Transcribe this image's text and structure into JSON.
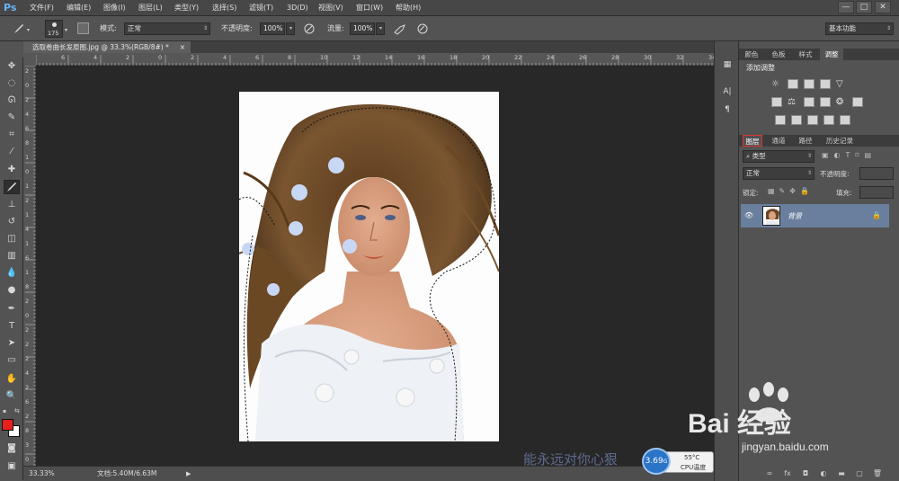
{
  "app": {
    "logo": "Ps"
  },
  "menu": [
    "文件(F)",
    "编辑(E)",
    "图像(I)",
    "图层(L)",
    "类型(Y)",
    "选择(S)",
    "滤镜(T)",
    "3D(D)",
    "视图(V)",
    "窗口(W)",
    "帮助(H)"
  ],
  "window_controls": [
    "—",
    "□",
    "✕"
  ],
  "options": {
    "brush_size": "175",
    "mode_label": "模式:",
    "mode_value": "正常",
    "opacity_label": "不透明度:",
    "opacity_value": "100%",
    "flow_label": "流量:",
    "flow_value": "100%",
    "workspace": "基本功能"
  },
  "document": {
    "tab_title": "选取卷曲长发原图.jpg @ 33.3%(RGB/8#) *",
    "close": "×"
  },
  "ruler_h": [
    "6",
    "4",
    "2",
    "0",
    "2",
    "4",
    "6",
    "8",
    "10",
    "12",
    "14",
    "16",
    "18",
    "20",
    "22",
    "24",
    "26",
    "28",
    "30",
    "32",
    "34"
  ],
  "ruler_v": [
    "2",
    "0",
    "2",
    "4",
    "6",
    "8",
    "1",
    "0",
    "1",
    "2",
    "1",
    "4",
    "1",
    "6",
    "1",
    "8",
    "2",
    "0",
    "2",
    "2",
    "2",
    "4",
    "2",
    "6",
    "2",
    "8",
    "3",
    "0"
  ],
  "status": {
    "zoom": "33.33%",
    "doc_info": "文档:5.40M/6.63M"
  },
  "panels": {
    "top_tabs": [
      "颜色",
      "色板",
      "样式",
      "调整"
    ],
    "adjust_title": "添加调整",
    "layer_tabs": [
      "图层",
      "通道",
      "路径",
      "历史记录"
    ],
    "filter_kind": "类型",
    "blend_mode": "正常",
    "opacity_label": "不透明度:",
    "lock_label": "锁定:",
    "fill_label": "填充:",
    "layers": [
      {
        "name": "背景",
        "visible": true,
        "locked": true
      }
    ]
  },
  "watermark": {
    "brand": "Bai 经验",
    "url": "jingyan.baidu.com"
  },
  "footer_caption": "能永远对你心狠",
  "cpu_widget": {
    "usage": "3.69",
    "unit": "G",
    "temp": "55°C",
    "label": "CPU温度"
  },
  "colors": {
    "foreground": "#e8201c",
    "background": "#ffffff",
    "layer_highlight": "#6a7f9e"
  }
}
